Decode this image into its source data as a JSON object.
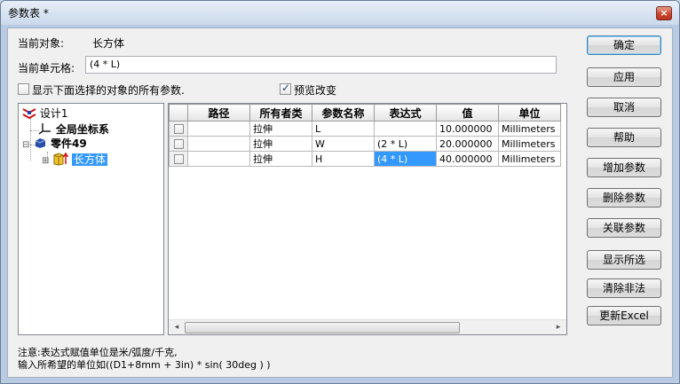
{
  "window": {
    "title": "参数表 *",
    "close_glyph": "×"
  },
  "current_object": {
    "label": "当前对象:",
    "value": "长方体"
  },
  "current_cell": {
    "label": "当前单元格:",
    "value": "(4 * L)"
  },
  "show_all_checkbox": {
    "label": "显示下面选择的对象的所有参数.",
    "checked": false
  },
  "preview_checkbox": {
    "label": "预览改变",
    "checked": true
  },
  "tree": {
    "root": {
      "label": "设计1",
      "icon": "design-icon"
    },
    "coordinate_system": {
      "label": "全局坐标系",
      "icon": "axis-icon"
    },
    "part": {
      "label": "零件49",
      "icon": "part-icon",
      "expander": "⊟"
    },
    "body": {
      "label": "长方体",
      "icon": "cuboid-icon",
      "expander": "⊞"
    }
  },
  "table": {
    "columns": [
      "",
      "路径",
      "所有者类",
      "参数名称",
      "表达式",
      "值",
      "单位"
    ],
    "rows": [
      {
        "path": "",
        "owner": "拉伸",
        "name": "L",
        "expression": "",
        "value": "10.000000",
        "unit": "Millimeters"
      },
      {
        "path": "",
        "owner": "拉伸",
        "name": "W",
        "expression": "(2 * L)",
        "value": "20.000000",
        "unit": "Millimeters"
      },
      {
        "path": "",
        "owner": "拉伸",
        "name": "H",
        "expression": "(4 * L)",
        "value": "40.000000",
        "unit": "Millimeters"
      }
    ],
    "scroll_left": "◂",
    "scroll_right": "▸"
  },
  "buttons": {
    "ok": "确定",
    "apply": "应用",
    "cancel": "取消",
    "help": "帮助",
    "add_param": "增加参数",
    "delete_param": "删除参数",
    "link_param": "关联参数",
    "show_selected": "显示所选",
    "clear_invalid": "清除非法",
    "update_excel": "更新Excel"
  },
  "notes": {
    "line1": "注意:表达式赋值单位是米/弧度/千克,",
    "line2": "输入所希望的单位如((D1+8mm + 3in) * sin( 30deg ) )"
  }
}
